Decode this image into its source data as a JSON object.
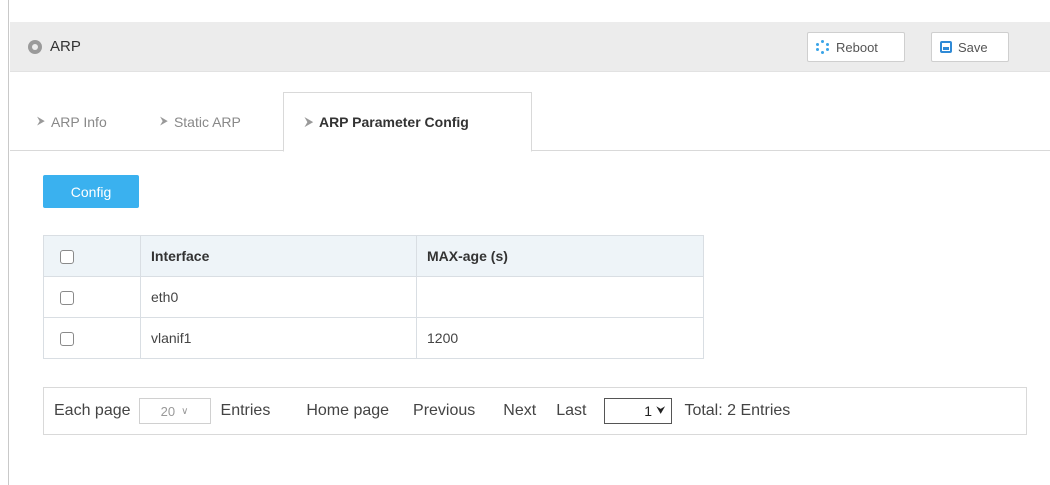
{
  "header": {
    "title": "ARP",
    "reboot_label": "Reboot",
    "save_label": "Save"
  },
  "tabs": [
    {
      "label": "ARP Info",
      "active": false
    },
    {
      "label": "Static ARP",
      "active": false
    },
    {
      "label": "ARP Parameter Config",
      "active": true
    }
  ],
  "toolbar": {
    "config_label": "Config"
  },
  "table": {
    "columns": [
      "Interface",
      "MAX-age (s)"
    ],
    "rows": [
      {
        "interface": "eth0",
        "max_age": ""
      },
      {
        "interface": "vlanif1",
        "max_age": "1200"
      }
    ]
  },
  "pager": {
    "each_page_label": "Each page",
    "page_size": "20",
    "entries_label": "Entries",
    "home_label": "Home page",
    "previous_label": "Previous",
    "next_label": "Next",
    "last_label": "Last",
    "current_page": "1",
    "total_label": "Total: 2 Entries"
  }
}
